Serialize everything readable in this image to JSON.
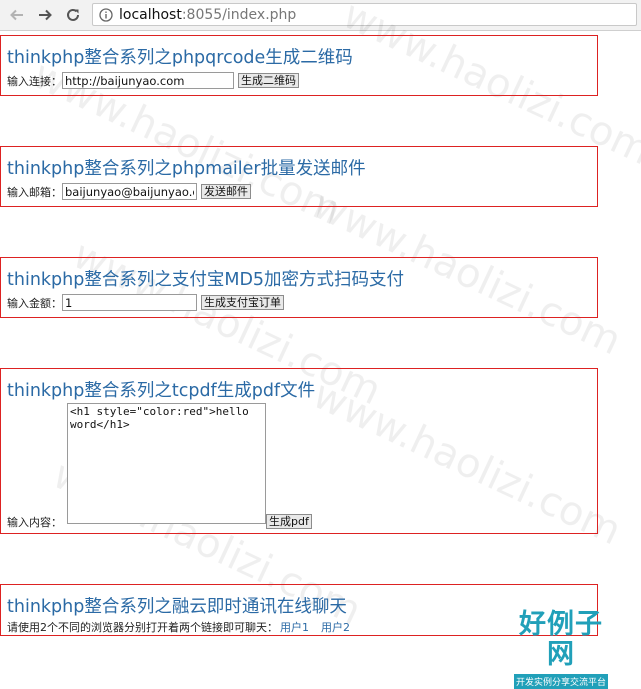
{
  "browser": {
    "url_host": "localhost",
    "url_rest": ":8055/index.php"
  },
  "sections": [
    {
      "title": "thinkphp整合系列之phpqrcode生成二维码",
      "label": "输入连接：",
      "input_value": "http://baijunyao.com",
      "button": "生成二维码"
    },
    {
      "title": "thinkphp整合系列之phpmailer批量发送邮件",
      "label": "输入邮箱：",
      "input_value": "baijunyao@baijunyao.com",
      "button": "发送邮件"
    },
    {
      "title": "thinkphp整合系列之支付宝MD5加密方式扫码支付",
      "label": "输入金额：",
      "input_value": "1",
      "button": "生成支付宝订单"
    },
    {
      "title": "thinkphp整合系列之tcpdf生成pdf文件",
      "label": "输入内容：",
      "textarea_value": "<h1 style=\"color:red\">hello word</h1>",
      "button": "生成pdf"
    },
    {
      "title": "thinkphp整合系列之融云即时通讯在线聊天",
      "text": "请使用2个不同的浏览器分别打开着两个链接即可聊天：",
      "links": [
        "用户1",
        "用户2"
      ]
    }
  ],
  "watermark": "www.haolizi.com",
  "logo": {
    "title": "好例子网",
    "subtitle": "开发实例分享交流平台"
  }
}
